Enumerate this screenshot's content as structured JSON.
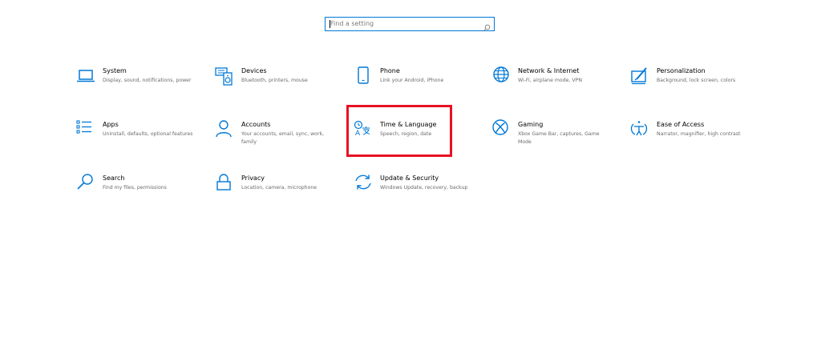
{
  "search": {
    "placeholder": "Find a setting"
  },
  "colors": {
    "accent": "#0078d7",
    "highlight": "#e81123"
  },
  "tiles": [
    {
      "title": "System",
      "desc": "Display, sound, notifications, power",
      "icon": "laptop-icon"
    },
    {
      "title": "Devices",
      "desc": "Bluetooth, printers, mouse",
      "icon": "keyboard-speaker-icon"
    },
    {
      "title": "Phone",
      "desc": "Link your Android, iPhone",
      "icon": "phone-icon"
    },
    {
      "title": "Network & Internet",
      "desc": "Wi-Fi, airplane mode, VPN",
      "icon": "globe-icon"
    },
    {
      "title": "Personalization",
      "desc": "Background, lock screen, colors",
      "icon": "pen-tablet-icon"
    },
    {
      "title": "Apps",
      "desc": "Uninstall, defaults, optional features",
      "icon": "apps-list-icon"
    },
    {
      "title": "Accounts",
      "desc": "Your accounts, email, sync, work, family",
      "icon": "person-icon"
    },
    {
      "title": "Time & Language",
      "desc": "Speech, region, date",
      "icon": "time-language-icon"
    },
    {
      "title": "Gaming",
      "desc": "Xbox Game Bar, captures, Game Mode",
      "icon": "xbox-icon"
    },
    {
      "title": "Ease of Access",
      "desc": "Narrator, magnifier, high contrast",
      "icon": "ease-of-access-icon"
    },
    {
      "title": "Search",
      "desc": "Find my files, permissions",
      "icon": "magnifier-icon"
    },
    {
      "title": "Privacy",
      "desc": "Location, camera, microphone",
      "icon": "lock-icon"
    },
    {
      "title": "Update & Security",
      "desc": "Windows Update, recovery, backup",
      "icon": "sync-arrows-icon"
    }
  ]
}
